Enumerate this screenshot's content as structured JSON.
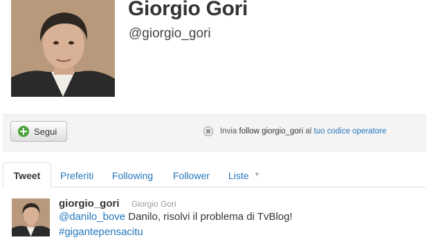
{
  "profile": {
    "name": "Giorgio Gori",
    "handle": "@giorgio_gori"
  },
  "actions": {
    "follow_label": "Segui",
    "sms_prefix": "Invia ",
    "sms_command": "follow giorgio_gori",
    "sms_middle": " al ",
    "sms_link": "tuo codice operatore"
  },
  "tabs": [
    {
      "label": "Tweet"
    },
    {
      "label": "Preferiti"
    },
    {
      "label": "Following"
    },
    {
      "label": "Follower"
    },
    {
      "label": "Liste"
    }
  ],
  "tweet": {
    "username": "giorgio_gori",
    "realname": "Giorgio Gori",
    "mention": "@danilo_bove",
    "text": " Danilo, risolvi il problema di TvBlog!",
    "hashtag": "#gigantepensacitu"
  },
  "icons": {
    "follow": "plus-circle-icon",
    "sms": "sms-phone-icon",
    "lists_menu": "chevron-down-icon"
  },
  "colors": {
    "link": "#2276bb",
    "follow_plus": "#4aa23a",
    "action_bar_bg": "#f4f4f4"
  }
}
